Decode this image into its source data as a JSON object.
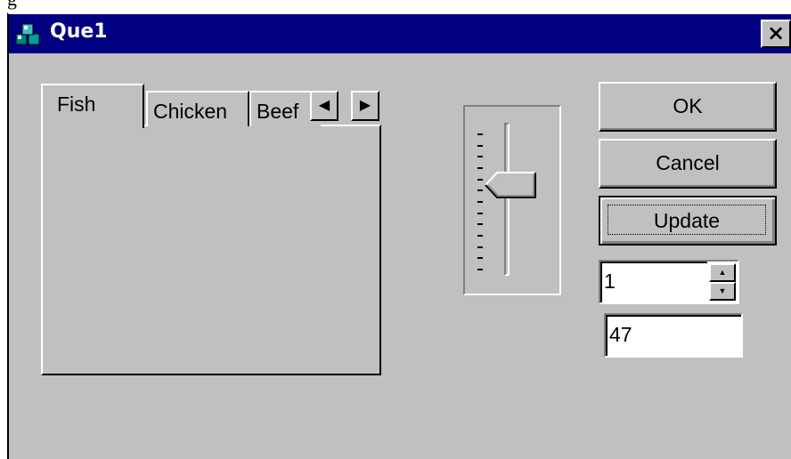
{
  "window": {
    "top_fragment": "g",
    "title": "Que1",
    "close_glyph": "×"
  },
  "tabs": [
    {
      "label": "Fish",
      "selected": true
    },
    {
      "label": "Chicken",
      "selected": false
    },
    {
      "label": "Beef",
      "selected": false
    }
  ],
  "tab_scroll": {
    "left_glyph": "◀",
    "right_glyph": "▶"
  },
  "trackbar": {
    "orientation": "vertical",
    "tick_count": 13,
    "position_fraction": 0.38
  },
  "buttons": {
    "ok": "OK",
    "cancel": "Cancel",
    "update": "Update"
  },
  "spin": {
    "value": "1",
    "up_glyph": "▲",
    "down_glyph": "▼"
  },
  "value_field": "47",
  "icons": {
    "app": "stacked-boxes-icon",
    "close": "close-icon"
  },
  "colors": {
    "face": "#c0c0c0",
    "title_bar": "#000080",
    "highlight": "#ffffff",
    "shadow": "#808080"
  }
}
